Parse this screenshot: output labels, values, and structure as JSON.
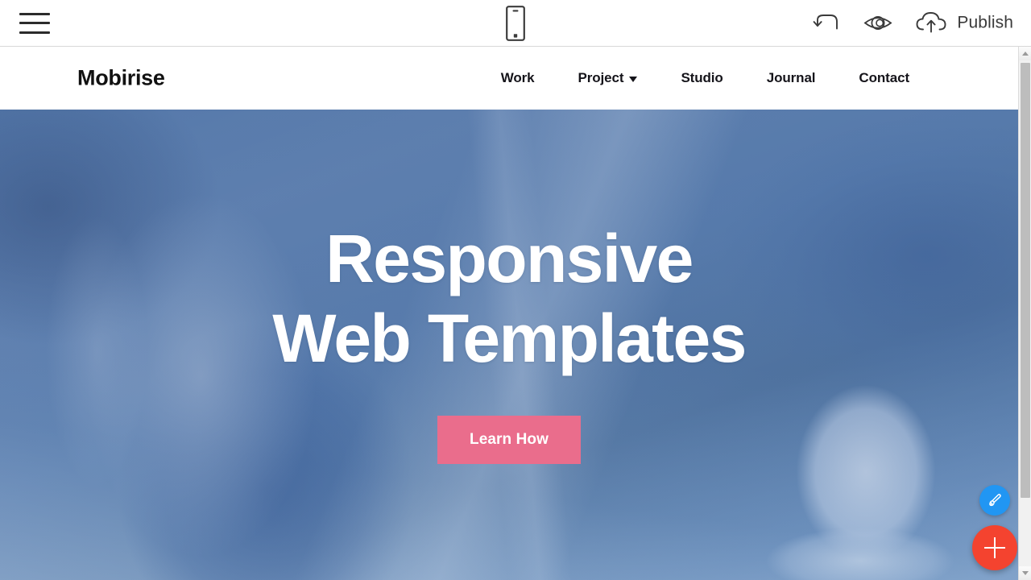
{
  "editor": {
    "toolbar": {
      "menu_icon": "hamburger-menu-icon",
      "device_icon": "mobile-device-icon",
      "undo_icon": "undo-arrow-icon",
      "preview_icon": "eye-preview-icon",
      "publish_icon": "cloud-upload-icon",
      "publish_label": "Publish"
    },
    "fabs": {
      "brush_icon": "paintbrush-icon",
      "brush_color": "#2196F3",
      "add_icon": "plus-icon",
      "add_color": "#F4432F"
    },
    "scrollbar": {
      "up_icon": "scroll-up-arrow-icon",
      "down_icon": "scroll-down-arrow-icon"
    }
  },
  "site": {
    "logo": "Mobirise",
    "menu": [
      {
        "label": "Work",
        "has_dropdown": false
      },
      {
        "label": "Project",
        "has_dropdown": true
      },
      {
        "label": "Studio",
        "has_dropdown": false
      },
      {
        "label": "Journal",
        "has_dropdown": false
      },
      {
        "label": "Contact",
        "has_dropdown": false
      }
    ],
    "hero": {
      "title_line1": "Responsive",
      "title_line2": "Web Templates",
      "cta_label": "Learn How",
      "cta_color": "#EA6D8C",
      "overlay_color": "#486CA0"
    }
  }
}
